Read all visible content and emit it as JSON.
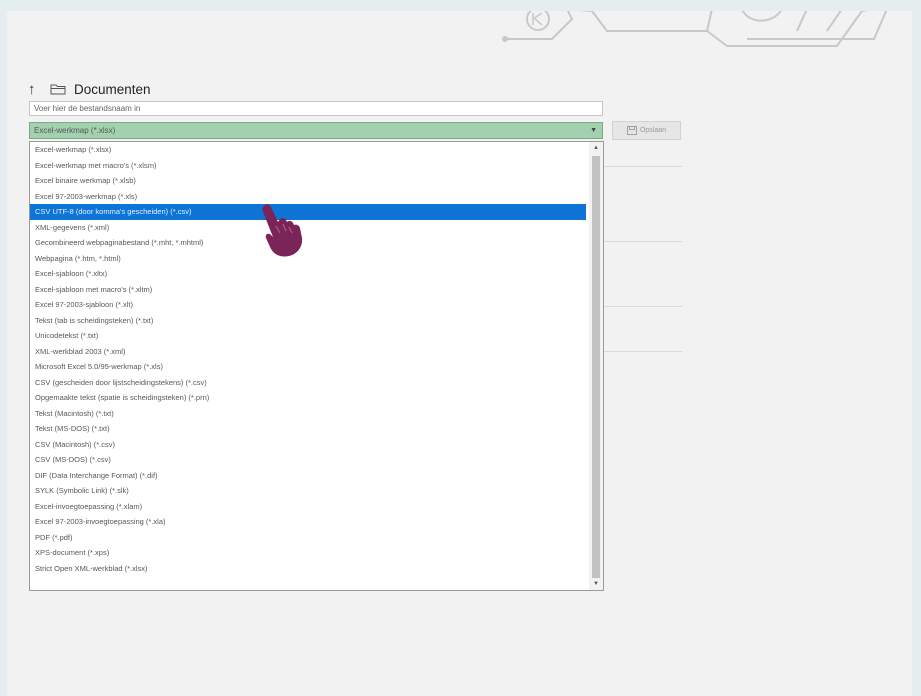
{
  "nav": {
    "title": "Documenten"
  },
  "dialog": {
    "filename_value": "Voer hier de bestandsnaam in",
    "filetype_selected": "Excel-werkmap (*.xlsx)",
    "save_button": "Opslaan"
  },
  "filetypes": [
    "Excel-werkmap (*.xlsx)",
    "Excel-werkmap met macro's (*.xlsm)",
    "Excel binaire werkmap (*.xlsb)",
    "Excel 97-2003-werkmap (*.xls)",
    "CSV UTF-8 (door komma's gescheiden) (*.csv)",
    "XML-gegevens (*.xml)",
    "Gecombineerd webpaginabestand (*.mht, *.mhtml)",
    "Webpagina (*.htm, *.html)",
    "Excel-sjabloon (*.xltx)",
    "Excel-sjabloon met macro's (*.xltm)",
    "Excel 97-2003-sjabloon (*.xlt)",
    "Tekst (tab is scheidingsteken) (*.txt)",
    "Unicodetekst (*.txt)",
    "XML-werkblad 2003 (*.xml)",
    "Microsoft Excel 5.0/95-werkmap (*.xls)",
    "CSV (gescheiden door lijstscheidingstekens) (*.csv)",
    "Opgemaakte tekst (spatie is scheidingsteken) (*.prn)",
    "Tekst (Macintosh) (*.txt)",
    "Tekst (MS-DOS) (*.txt)",
    "CSV (Macintosh) (*.csv)",
    "CSV (MS-DOS) (*.csv)",
    "DIF (Data Interchange Format) (*.dif)",
    "SYLK (Symbolic Link) (*.slk)",
    "Excel-invoegtoepassing (*.xlam)",
    "Excel 97-2003-invoegtoepassing (*.xla)",
    "PDF (*.pdf)",
    "XPS-document (*.xps)",
    "Strict Open XML-werkblad (*.xlsx)"
  ],
  "selected_index": 4,
  "colors": {
    "selection": "#0e74d6",
    "filetype_field": "#a3d1b0",
    "cursor": "#7a2557"
  },
  "icons": [
    "up-arrow-icon",
    "folder-icon",
    "save-icon",
    "chevron-down-icon",
    "hand-pointer-icon"
  ]
}
